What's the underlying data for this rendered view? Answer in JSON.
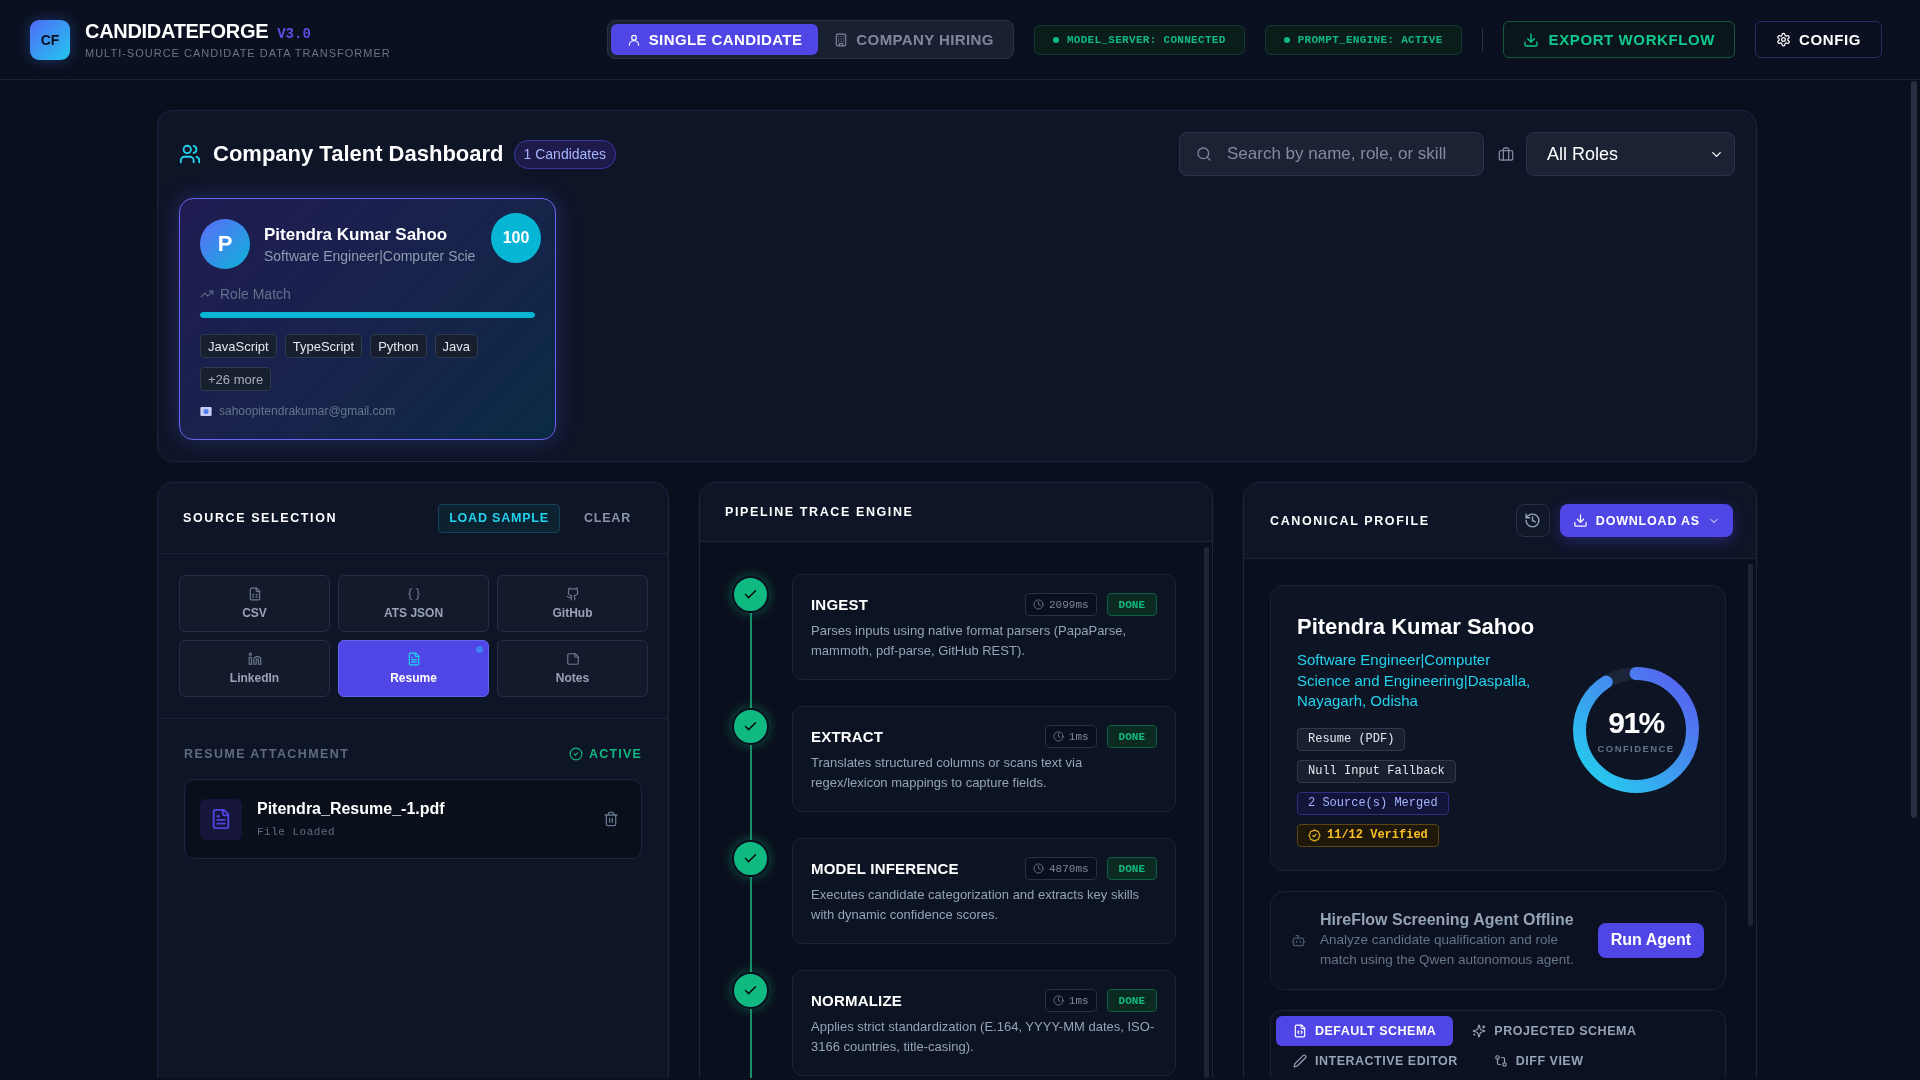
{
  "header": {
    "logo": "CF",
    "title": "CANDIDATEFORGE",
    "version": "V3.0",
    "subtitle": "MULTI-SOURCE CANDIDATE DATA TRANSFORMER",
    "mode_tabs": [
      {
        "label": "SINGLE CANDIDATE",
        "kind": "person",
        "selected": true
      },
      {
        "label": "COMPANY HIRING",
        "kind": "building",
        "selected": false
      }
    ],
    "status_pills": [
      "MODEL_SERVER: CONNECTED",
      "PROMPT_ENGINE: ACTIVE"
    ],
    "export_button": "EXPORT WORKFLOW",
    "config_button": "CONFIG"
  },
  "dashboard": {
    "title": "Company Talent Dashboard",
    "count_badge": "1 Candidates",
    "search": {
      "placeholder": "Search by name, role, or skill"
    },
    "role_filter": {
      "value": "All Roles"
    },
    "candidates": [
      {
        "initial": "P",
        "name": "Pitendra Kumar Sahoo",
        "headline": "Software Engineer|Computer Scie",
        "score": "100",
        "match_label": "Role Match",
        "level": 1,
        "skills": [
          "JavaScript",
          "TypeScript",
          "Python",
          "Java"
        ],
        "more_skills": "+26 more",
        "email": "sahoopitendrakumar@gmail.com",
        "selected": true
      }
    ]
  },
  "source_selection": {
    "title": "SOURCE SELECTION",
    "load_sample_button": "LOAD SAMPLE",
    "clear_button": "CLEAR",
    "sources": [
      {
        "label": "CSV",
        "kind": "csv",
        "selected": false,
        "loaded": false
      },
      {
        "label": "ATS JSON",
        "kind": "json",
        "selected": false,
        "loaded": false
      },
      {
        "label": "GitHub",
        "kind": "github",
        "selected": false,
        "loaded": false
      },
      {
        "label": "LinkedIn",
        "kind": "linkedin",
        "selected": false,
        "loaded": false
      },
      {
        "label": "Resume",
        "kind": "resume",
        "selected": true,
        "loaded": true
      },
      {
        "label": "Notes",
        "kind": "notes",
        "selected": false,
        "loaded": false
      }
    ],
    "attachment": {
      "title": "RESUME ATTACHMENT",
      "status": "ACTIVE",
      "file_name": "Pitendra_Resume_-1.pdf",
      "file_status": "File Loaded"
    }
  },
  "pipeline": {
    "title": "PIPELINE TRACE ENGINE",
    "steps": [
      {
        "name": "INGEST",
        "duration": "2099ms",
        "status": "DONE",
        "completed": true,
        "description": "Parses inputs using native format parsers (PapaParse, mammoth, pdf-parse, GitHub REST)."
      },
      {
        "name": "EXTRACT",
        "duration": "1ms",
        "status": "DONE",
        "completed": true,
        "description": "Translates structured columns or scans text via regex/lexicon mappings to capture fields."
      },
      {
        "name": "MODEL INFERENCE",
        "duration": "4870ms",
        "status": "DONE",
        "completed": true,
        "description": "Executes candidate categorization and extracts key skills with dynamic confidence scores."
      },
      {
        "name": "NORMALIZE",
        "duration": "1ms",
        "status": "DONE",
        "completed": true,
        "description": "Applies strict standardization (E.164, YYYY-MM dates, ISO-3166 countries, title-casing)."
      }
    ]
  },
  "canonical_profile": {
    "title": "CANONICAL PROFILE",
    "download_button": "DOWNLOAD AS",
    "profile": {
      "name": "Pitendra Kumar Sahoo",
      "headline": "Software Engineer|Computer Science and Engineering|Daspalla, Nayagarh, Odisha",
      "tags": [
        {
          "label": "Resume (PDF)",
          "kind": "source"
        },
        {
          "label": "Null Input Fallback",
          "kind": "source"
        },
        {
          "label": "2 Source(s) Merged",
          "kind": "merged"
        },
        {
          "label": "11/12 Verified",
          "kind": "verified"
        }
      ],
      "confidence": {
        "value": "91%",
        "label": "CONFIDENCE",
        "level": 0.91
      }
    },
    "agent": {
      "title": "HireFlow Screening Agent Offline",
      "description": "Analyze candidate qualification and role match using the Qwen autonomous agent.",
      "button": "Run Agent"
    },
    "schema_tabs": [
      {
        "label": "DEFAULT SCHEMA",
        "kind": "code",
        "selected": true
      },
      {
        "label": "PROJECTED SCHEMA",
        "kind": "sparkle",
        "selected": false
      },
      {
        "label": "INTERACTIVE EDITOR",
        "kind": "edit",
        "selected": false
      },
      {
        "label": "DIFF VIEW",
        "kind": "diff",
        "selected": false
      }
    ]
  }
}
